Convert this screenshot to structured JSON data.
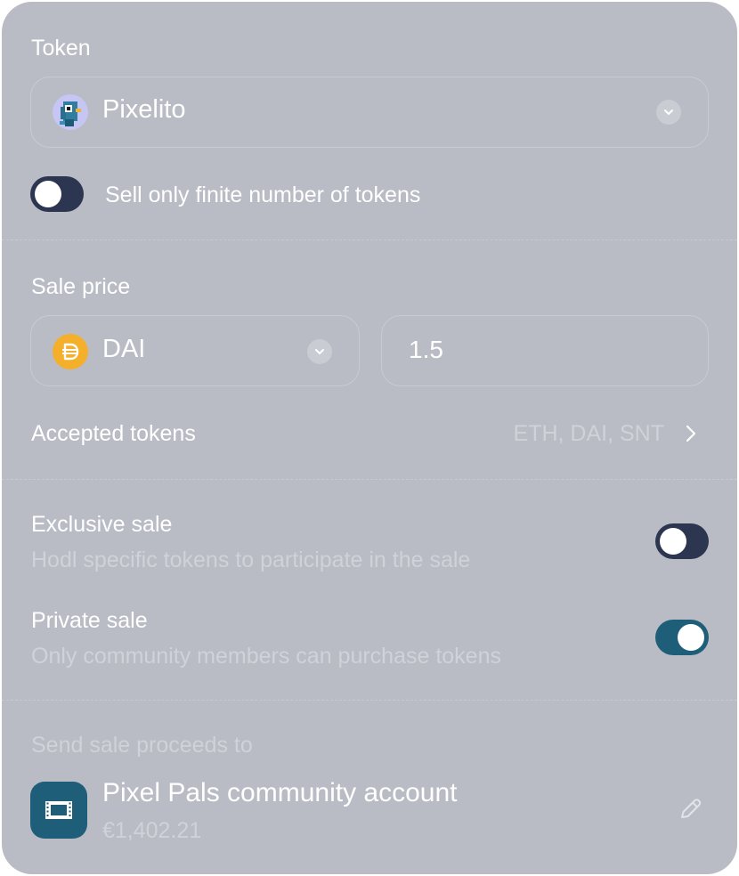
{
  "token_section": {
    "label": "Token",
    "selected_token": "Pixelito",
    "icon": "pixel-bird-icon"
  },
  "finite_tokens": {
    "label": "Sell only finite number of tokens",
    "enabled": false
  },
  "sale_price": {
    "label": "Sale price",
    "currency": "DAI",
    "currency_icon": "dai-icon",
    "amount": "1.5"
  },
  "accepted_tokens": {
    "label": "Accepted tokens",
    "value": "ETH, DAI, SNT"
  },
  "exclusive_sale": {
    "title": "Exclusive sale",
    "description": "Hodl specific tokens to participate in the sale",
    "enabled": false
  },
  "private_sale": {
    "title": "Private sale",
    "description": "Only community members can purchase tokens",
    "enabled": true
  },
  "proceeds": {
    "label": "Send sale proceeds to",
    "account_name": "Pixel Pals community account",
    "balance": "€1,402.21",
    "account_icon": "film-strip-icon",
    "edit_icon": "pencil-icon"
  },
  "colors": {
    "card_background": "#b9bcc4",
    "toggle_off": "#2d3650",
    "toggle_on": "#1f5e79",
    "dai_orange": "#f4b02a",
    "account_icon_bg": "#1f5e79"
  }
}
